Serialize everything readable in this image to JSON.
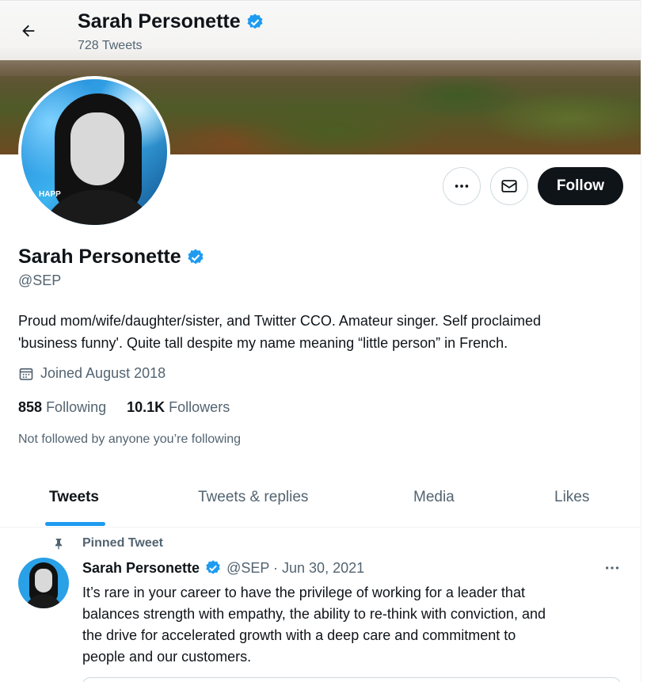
{
  "header": {
    "name": "Sarah Personette",
    "tweet_count": "728 Tweets"
  },
  "profile": {
    "name": "Sarah Personette",
    "handle": "@SEP",
    "bio_line1": "Proud mom/wife/daughter/sister, and Twitter CCO. Amateur singer. Self proclaimed",
    "bio_line2": "'business funny'. Quite tall despite my name meaning “little person” in French.",
    "joined": "Joined August 2018",
    "following_count": "858",
    "following_label": "Following",
    "followers_count": "10.1K",
    "followers_label": "Followers",
    "not_followed": "Not followed by anyone you’re following",
    "avatar_tag": "HAPP"
  },
  "actions": {
    "follow_label": "Follow"
  },
  "tabs": [
    {
      "label": "Tweets",
      "active": true
    },
    {
      "label": "Tweets & replies",
      "active": false
    },
    {
      "label": "Media",
      "active": false
    },
    {
      "label": "Likes",
      "active": false
    }
  ],
  "tweet": {
    "pinned_label": "Pinned Tweet",
    "author": "Sarah Personette",
    "meta": "@SEP · Jun 30, 2021",
    "line1": "It’s rare in your career to have the privilege of working for a leader that",
    "line2": "balances strength with empathy, the ability to re-think with conviction, and",
    "line3": "the drive for accelerated growth with a deep care and commitment to",
    "line4": "people and our customers."
  },
  "colors": {
    "accent": "#1d9bf0",
    "text": "#0f1419",
    "secondary": "#536471",
    "follow_bg": "#0f1419"
  },
  "icons": [
    "back-arrow-icon",
    "verified-badge-icon",
    "more-icon",
    "mail-icon",
    "calendar-icon",
    "pin-icon"
  ]
}
